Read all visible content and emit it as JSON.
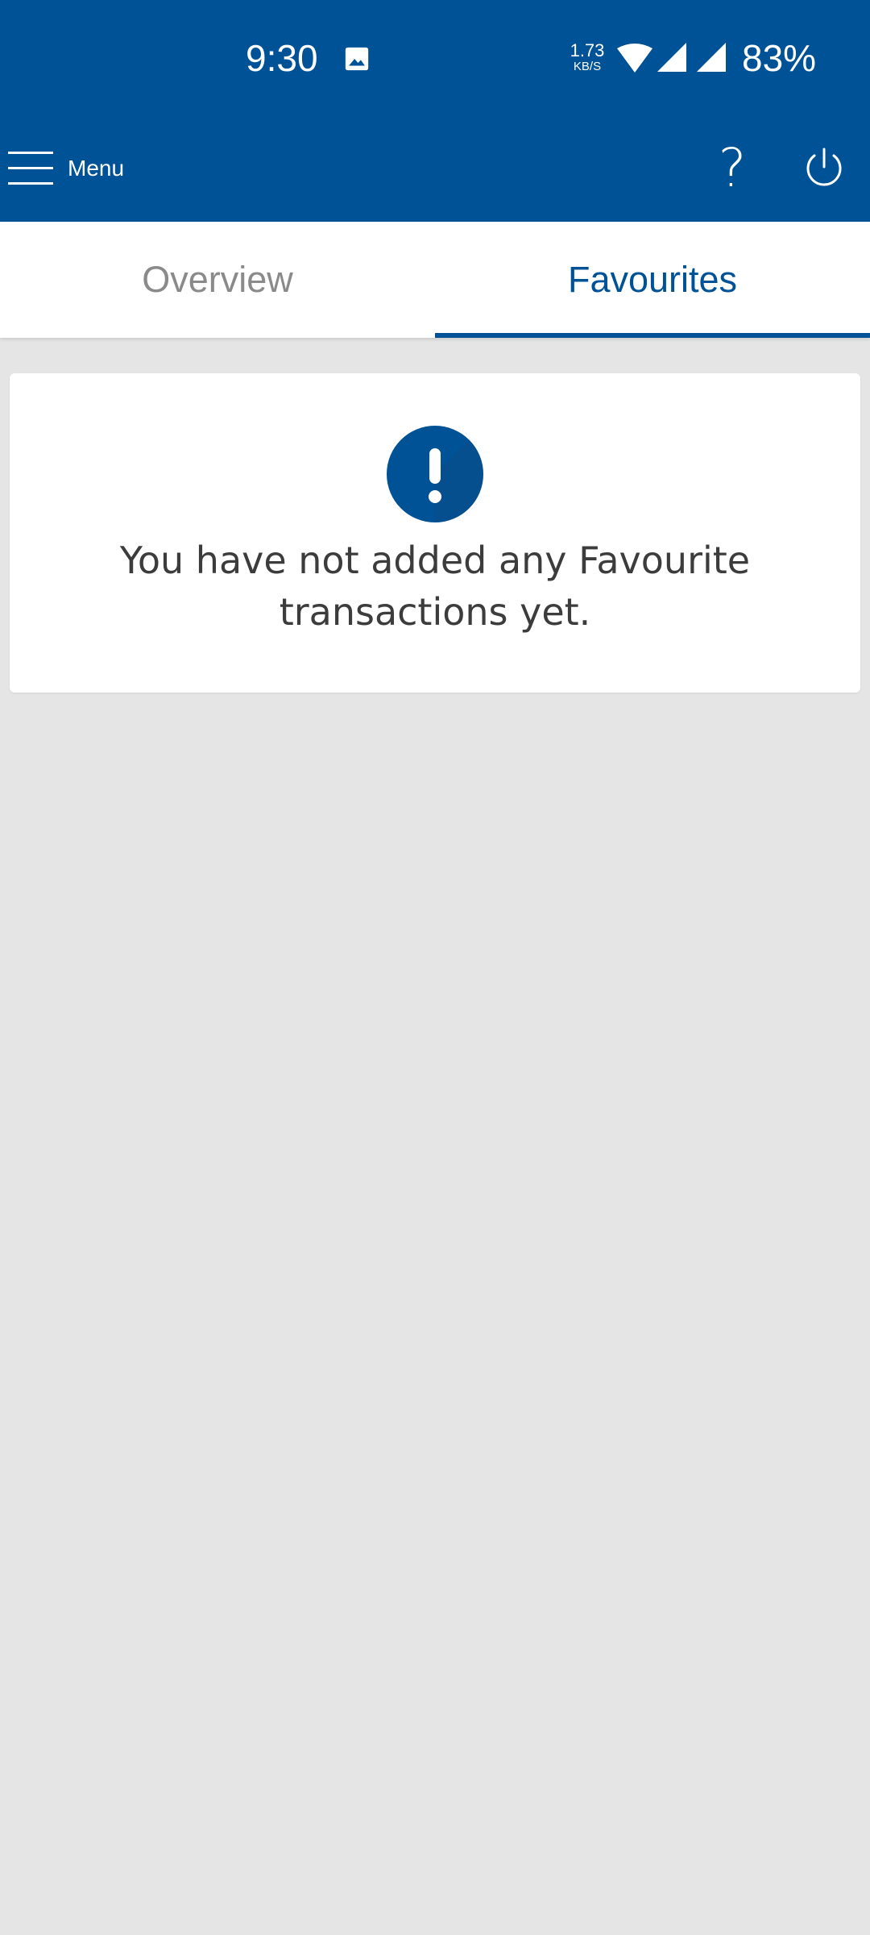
{
  "status_bar": {
    "time": "9:30",
    "network_speed_value": "1.73",
    "network_speed_unit": "KB/S",
    "battery": "83%",
    "icons": [
      "image-icon",
      "wifi-icon",
      "signal-icon",
      "signal-icon"
    ]
  },
  "header": {
    "menu_label": "Menu",
    "help_label": "?",
    "icons": [
      "hamburger-menu-icon",
      "power-icon"
    ]
  },
  "tabs": [
    {
      "label": "Overview",
      "selected": false
    },
    {
      "label": "Favourites",
      "selected": true
    }
  ],
  "notice": {
    "icon": "exclamation-icon",
    "message": "You have not added any Favourite transactions yet."
  },
  "colors": {
    "primary": "#005297",
    "background": "#e5e5e5",
    "card": "#ffffff",
    "tab_inactive": "#8a8a8a",
    "text": "#3c3c3c"
  }
}
